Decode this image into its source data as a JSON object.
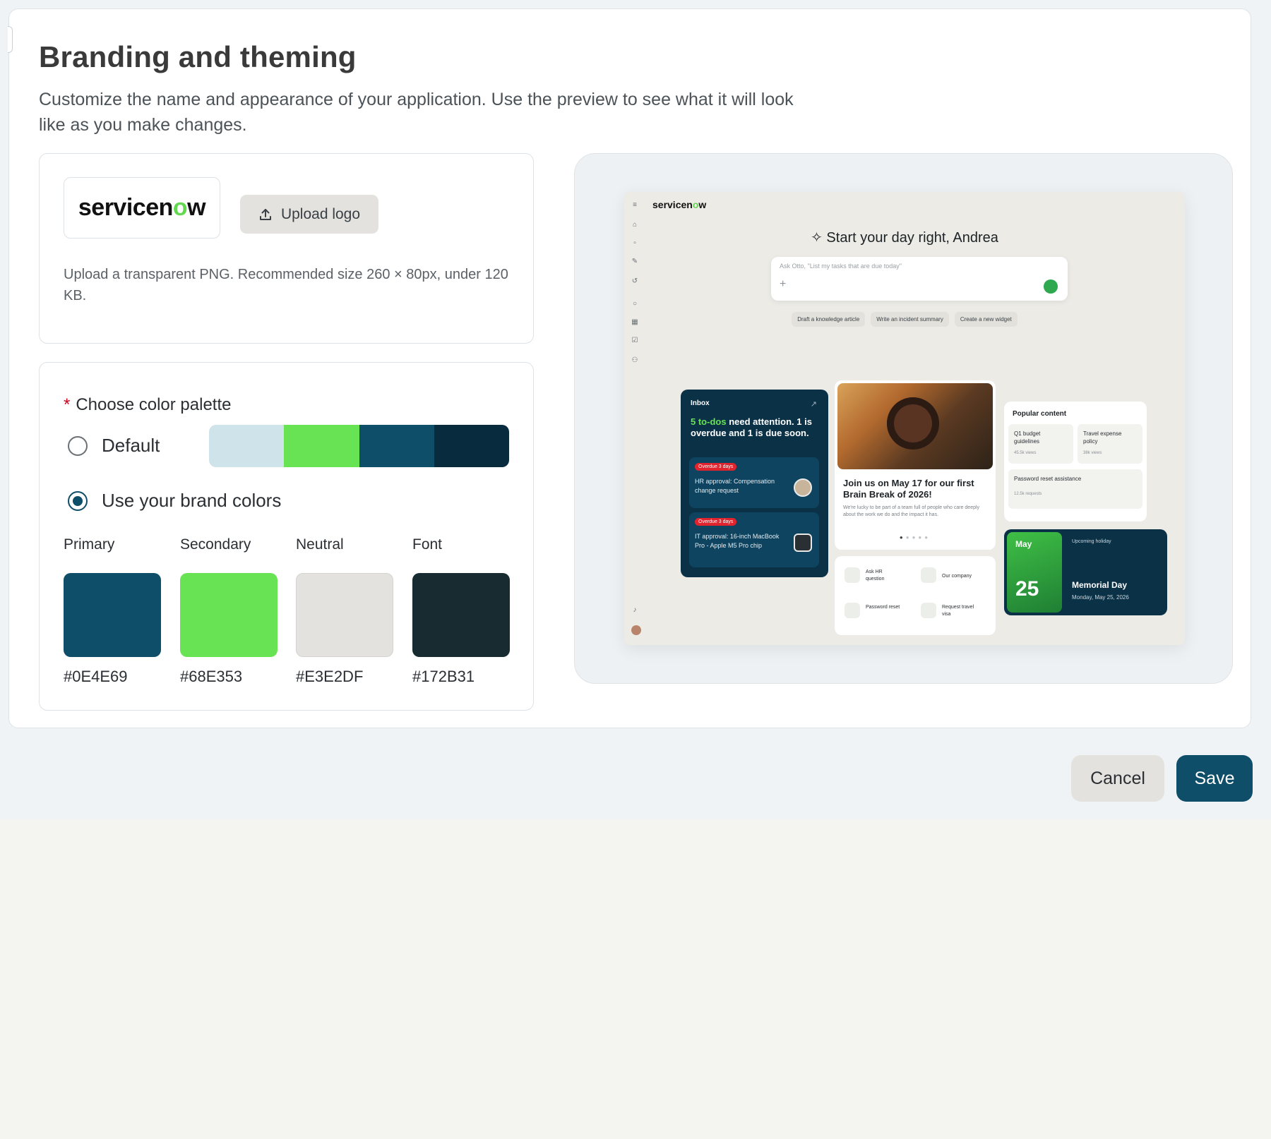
{
  "page": {
    "title": "Branding and theming",
    "subtitle": "Customize the name and appearance of your application. Use the preview to see what it will look like as you make changes."
  },
  "logo": {
    "brand_text": "servicenow",
    "upload_label": "Upload logo",
    "upload_icon": "upload-icon",
    "hint": "Upload a transparent PNG. Recommended size 260 × 80px, under 120 KB."
  },
  "palette": {
    "required_marker": "*",
    "label": "Choose color palette",
    "options": [
      {
        "label": "Default",
        "selected": false
      },
      {
        "label": "Use your brand colors",
        "selected": true
      }
    ],
    "default_strip_colors": [
      "#cfe3ea",
      "#68e353",
      "#0e4e69",
      "#082c3e"
    ],
    "swatches": [
      {
        "name": "Primary",
        "hex": "#0E4E69"
      },
      {
        "name": "Secondary",
        "hex": "#68E353"
      },
      {
        "name": "Neutral",
        "hex": "#E3E2DF"
      },
      {
        "name": "Font",
        "hex": "#172B31"
      }
    ]
  },
  "preview": {
    "brand": "servicenow",
    "greeting": "Start your day right, Andrea",
    "search_placeholder": "Ask Otto, \"List my tasks that are due today\"",
    "chips": [
      "Draft a knowledge article",
      "Write an incident summary",
      "Create a new widget"
    ],
    "inbox": {
      "header": "Inbox",
      "highlight": "5 to-dos",
      "message": "need attention. 1 is overdue and 1 is due soon.",
      "tasks": [
        {
          "badge": "Overdue 3 days",
          "text": "HR approval: Compensation change request"
        },
        {
          "badge": "Overdue 3 days",
          "text": "IT approval: 16-inch MacBook Pro - Apple M5 Pro chip"
        }
      ]
    },
    "promo": {
      "title": "Join us on May 17 for our first Brain Break of 2026!",
      "description": "We're lucky to be part of a team full of people who care deeply about the work we do and the impact it has."
    },
    "quick_links": [
      "Ask HR question",
      "Our company",
      "Password reset",
      "Request travel visa"
    ],
    "popular": {
      "header": "Popular content",
      "items": [
        {
          "title": "Q1 budget guidelines",
          "meta": "45.5k views"
        },
        {
          "title": "Travel expense policy",
          "meta": "38k views"
        },
        {
          "title": "Password reset assistance",
          "meta": "12.5k requests"
        }
      ]
    },
    "holiday": {
      "month": "May",
      "day": "25",
      "label": "Upcoming holiday",
      "name": "Memorial Day",
      "date": "Monday, May 25, 2026"
    }
  },
  "actions": {
    "cancel": "Cancel",
    "save": "Save"
  }
}
